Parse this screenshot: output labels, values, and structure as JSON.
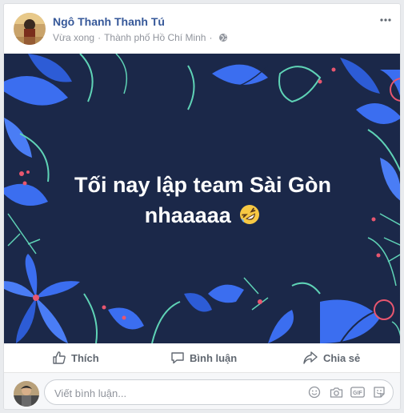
{
  "post": {
    "author": "Ngô Thanh Thanh Tú",
    "time": "Vừa xong",
    "location": "Thành phố Hồ Chí Minh",
    "privacy_icon": "globe-icon",
    "text_line1": "Tối nay lập team Sài Gòn",
    "text_line2": "nhaaaaa",
    "emoji": "rolling-on-floor-laughing-emoji"
  },
  "actions": {
    "like": "Thích",
    "comment": "Bình luận",
    "share": "Chia sẻ"
  },
  "comment_box": {
    "placeholder": "Viết bình luận...",
    "icons": [
      "emoji-icon",
      "camera-icon",
      "gif-icon",
      "sticker-icon"
    ]
  },
  "colors": {
    "author": "#365899",
    "post_background": "#1b2849",
    "leaf_blue": "#3b6ef0",
    "line_teal": "#5fd3b6",
    "accent_pink": "#e8566f"
  }
}
